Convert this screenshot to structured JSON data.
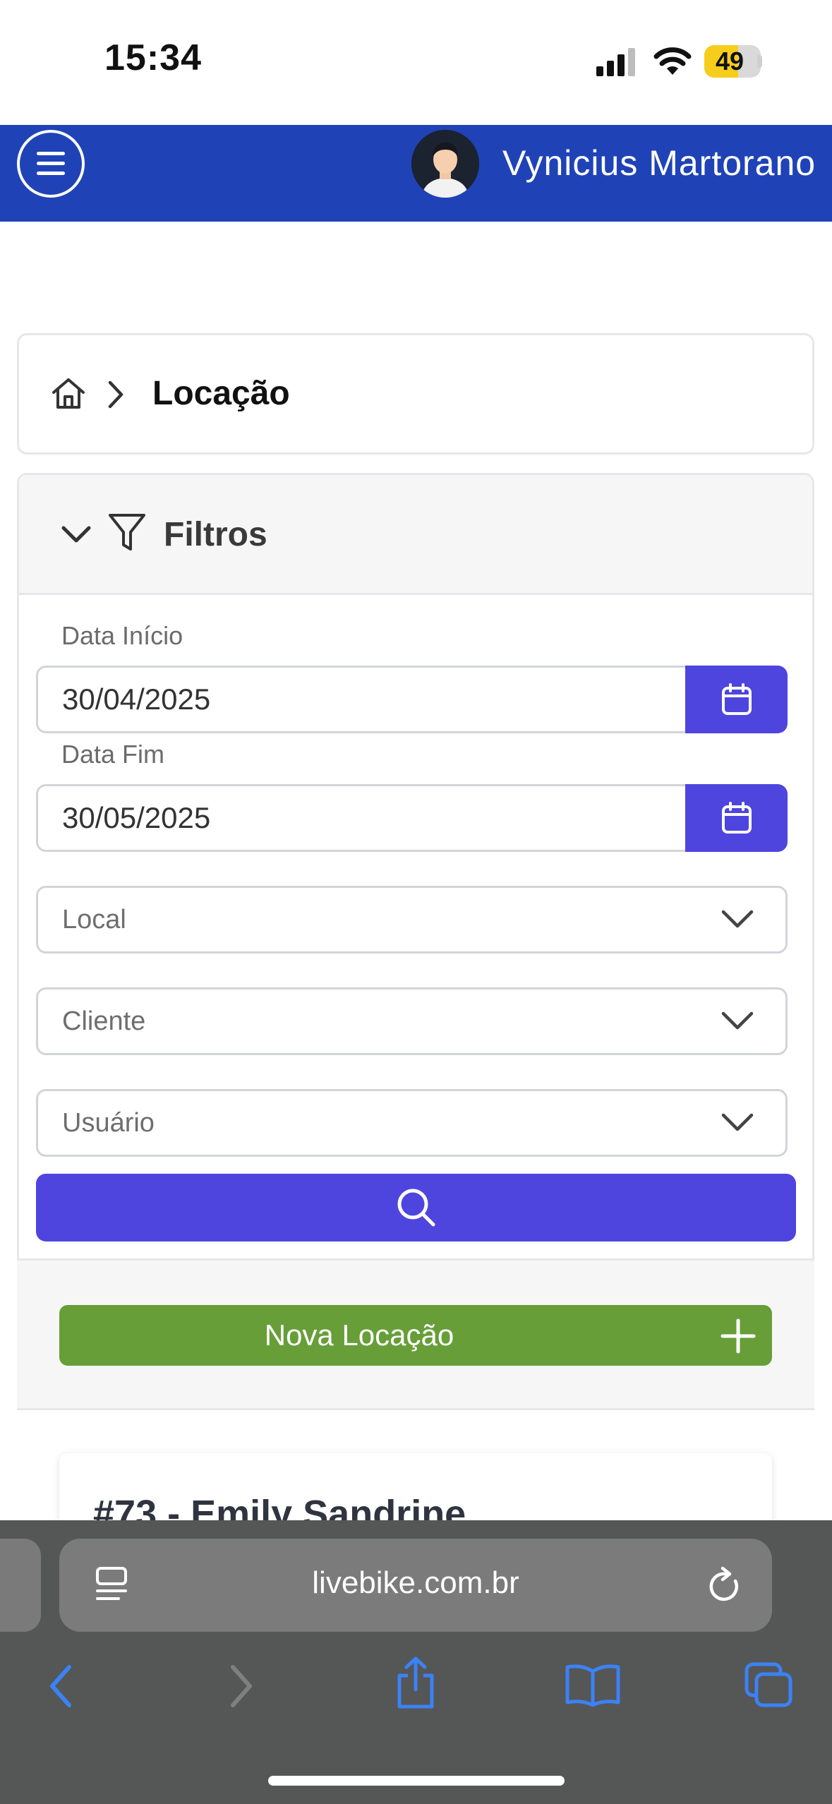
{
  "status_bar": {
    "time": "15:34",
    "battery": "49"
  },
  "header": {
    "user_name": "Vynicius Martorano"
  },
  "breadcrumb": {
    "current": "Locação"
  },
  "filters": {
    "title": "Filtros",
    "date_start": {
      "label": "Data Início",
      "value": "30/04/2025"
    },
    "date_end": {
      "label": "Data Fim",
      "value": "30/05/2025"
    },
    "local": {
      "placeholder": "Local"
    },
    "cliente": {
      "placeholder": "Cliente"
    },
    "usuario": {
      "placeholder": "Usuário"
    }
  },
  "actions": {
    "new_label": "Nova Locação"
  },
  "records": [
    {
      "title": "#73 - Emily Sandrine"
    }
  ],
  "browser": {
    "url": "livebike.com.br"
  },
  "colors": {
    "header_blue": "#1f43b7",
    "primary": "#4e45df",
    "success": "#679e38",
    "browser_bar": "#555656"
  }
}
